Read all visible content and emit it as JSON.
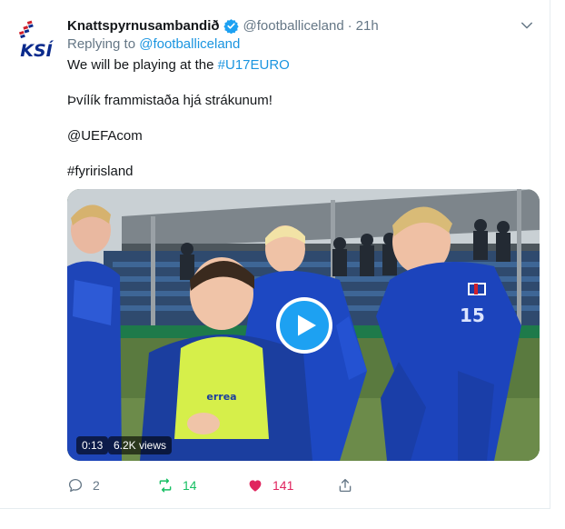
{
  "tweet": {
    "display_name": "Knattspyrnusambandið",
    "handle": "@footballiceland",
    "separator": "·",
    "time": "21h",
    "replying_prefix": "Replying to",
    "replying_handle": "@footballiceland",
    "line1_prefix": "We will be playing at the",
    "line1_hashtag": "#U17EURO",
    "line2": "Þvílík frammistaða hjá strákunum!",
    "mention": "@UEFAcom",
    "hashtag": "#fyririsland",
    "avatar_logo_text": "KSÍ"
  },
  "video": {
    "duration": "0:13",
    "views": "6.2K views",
    "jersey_number": "15",
    "vest_text": "errea"
  },
  "actions": {
    "reply_count": "2",
    "retweet_count": "14",
    "like_count": "141"
  },
  "icons": {
    "verified": "verified-badge-icon",
    "caret": "chevron-down-icon",
    "reply": "reply-icon",
    "retweet": "retweet-icon",
    "like": "heart-icon",
    "share": "share-icon",
    "play": "play-icon"
  },
  "colors": {
    "link": "#1b95e0",
    "secondary_text": "#657786",
    "retweet_green": "#17bf63",
    "like_red": "#e0245e",
    "play_blue": "#1da1f2",
    "ksi_blue": "#0a2a8c"
  }
}
